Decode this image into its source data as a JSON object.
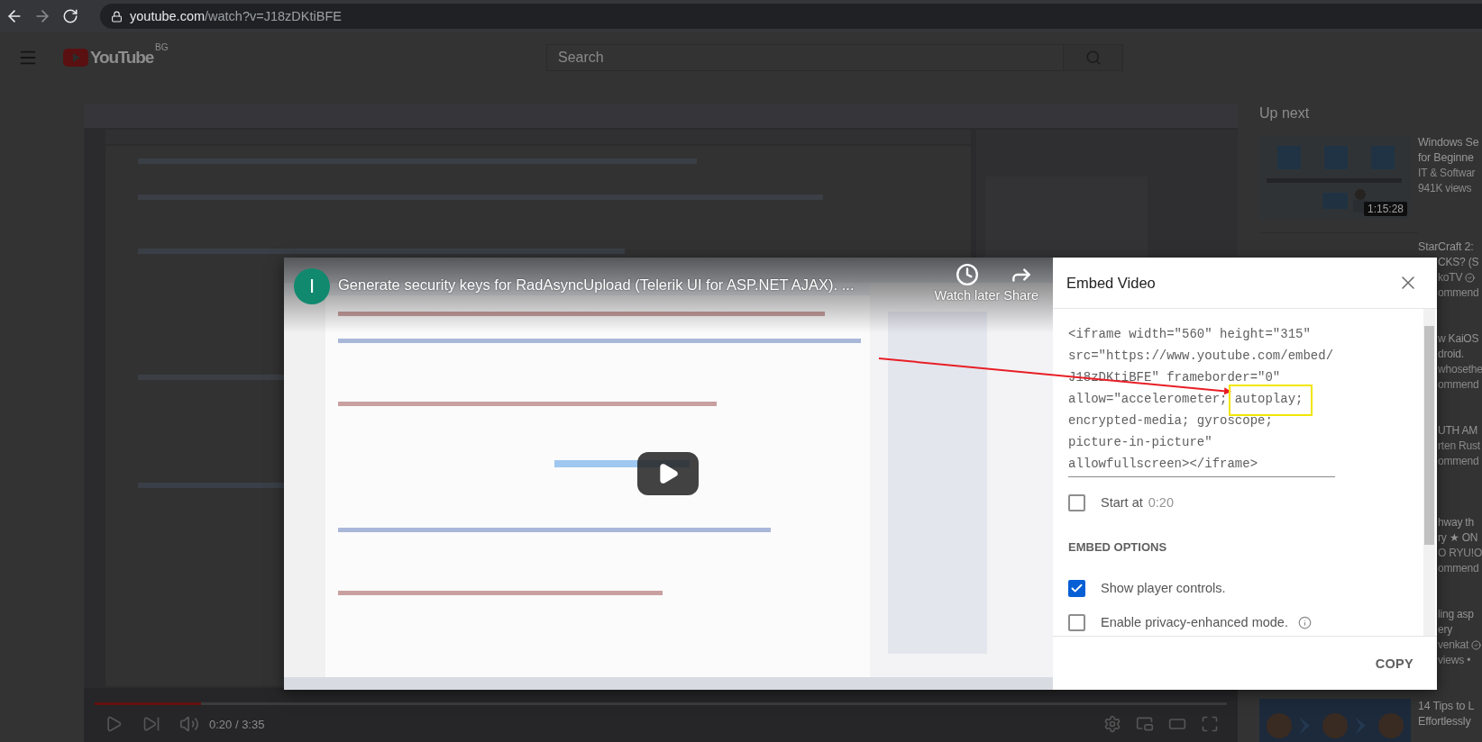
{
  "browser": {
    "url_host": "youtube.com",
    "url_path": "/watch?v=J18zDKtiBFE"
  },
  "header": {
    "logo": "YouTube",
    "country": "BG",
    "search_placeholder": "Search"
  },
  "player": {
    "progress": {
      "level": 0.094
    },
    "time": "0:20 / 3:35"
  },
  "up_next": {
    "heading": "Up next",
    "items": [
      {
        "kind": "visible",
        "title": [
          "Windows Se",
          "for Beginne"
        ],
        "meta": [
          "IT & Softwar",
          "941K views"
        ],
        "duration": "1:15:28"
      },
      {
        "kind": "half",
        "title": [
          "StarCraft 2:",
          "CKS? (S"
        ],
        "meta": [
          "koTV",
          "ommend"
        ],
        "verified": true
      },
      {
        "kind": "covered",
        "title": [
          "w KaiOS",
          "droid."
        ],
        "meta": [
          "whosethe",
          "ommend"
        ]
      },
      {
        "kind": "covered",
        "title": [
          "UTH AM"
        ],
        "meta": [
          "rten Rust",
          "ommend"
        ]
      },
      {
        "kind": "covered",
        "title": [
          "hway th",
          "ry ★ ON"
        ],
        "meta": [
          "O RYU!O",
          "ommend"
        ]
      },
      {
        "kind": "covered",
        "title": [
          "ling asp",
          "ery"
        ],
        "meta": [
          "venkat",
          "views •"
        ],
        "verified": true
      },
      {
        "kind": "visible",
        "title": [
          "14 Tips to L",
          "Effortlessly"
        ]
      }
    ]
  },
  "embed": {
    "preview": {
      "channel_initial": "I",
      "title": "Generate security keys for RadAsyncUpload (Telerik UI for ASP.NET AJAX). ...",
      "actions": [
        {
          "kind": "watch-later",
          "label": "Watch later"
        },
        {
          "kind": "share",
          "label": "Share"
        }
      ]
    },
    "title": "Embed Video",
    "code": "<iframe width=\"560\" height=\"315\" src=\"https://www.youtube.com/embed/J18zDKtiBFE\" frameborder=\"0\" allow=\"accelerometer; autoplay; encrypted-media; gyroscope; picture-in-picture\" allowfullscreen></iframe>",
    "start_at": {
      "label": "Start at",
      "checked": false,
      "value": "0:20"
    },
    "options_heading": "EMBED OPTIONS",
    "options": [
      {
        "label": "Show player controls.",
        "checked": true,
        "info": false
      },
      {
        "label": "Enable privacy-enhanced mode.",
        "checked": false,
        "info": true
      }
    ],
    "copy": "COPY"
  }
}
